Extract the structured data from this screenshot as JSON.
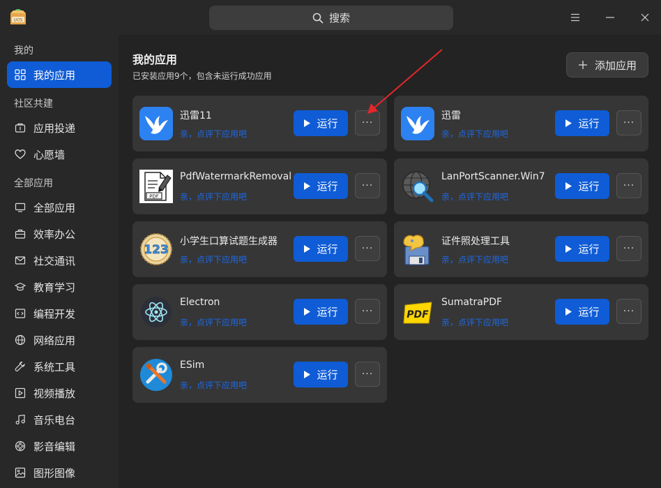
{
  "titlebar": {
    "logo_text": "UOS",
    "search_placeholder": "搜索",
    "icons": [
      "menu-icon",
      "minimize-icon",
      "close-icon"
    ]
  },
  "sidebar": {
    "groups": [
      {
        "label": "我的",
        "items": [
          {
            "label": "我的应用",
            "icon": "grid-icon",
            "active": true
          }
        ]
      },
      {
        "label": "社区共建",
        "items": [
          {
            "label": "应用投递",
            "icon": "upload-icon"
          },
          {
            "label": "心愿墙",
            "icon": "heart-icon"
          }
        ]
      },
      {
        "label": "全部应用",
        "items": [
          {
            "label": "全部应用",
            "icon": "monitor-icon"
          },
          {
            "label": "效率办公",
            "icon": "briefcase-icon"
          },
          {
            "label": "社交通讯",
            "icon": "mail-icon"
          },
          {
            "label": "教育学习",
            "icon": "graduation-cap-icon"
          },
          {
            "label": "编程开发",
            "icon": "code-icon"
          },
          {
            "label": "网络应用",
            "icon": "globe-icon"
          },
          {
            "label": "系统工具",
            "icon": "wrench-icon"
          },
          {
            "label": "视频播放",
            "icon": "play-icon"
          },
          {
            "label": "音乐电台",
            "icon": "music-icon"
          },
          {
            "label": "影音编辑",
            "icon": "film-reel-icon"
          },
          {
            "label": "图形图像",
            "icon": "image-icon"
          }
        ]
      }
    ]
  },
  "main": {
    "title": "我的应用",
    "subtitle": "已安装应用9个，包含未运行成功应用",
    "add_label": "添加应用",
    "run_label": "运行",
    "rate_label": "亲，点评下应用吧",
    "more_label": "···",
    "apps": [
      {
        "name": "迅雷11",
        "icon": "thunder-icon"
      },
      {
        "name": "迅雷",
        "icon": "thunder-icon"
      },
      {
        "name": "PdfWatermarkRemoval",
        "icon": "pdf-watermark-icon"
      },
      {
        "name": "LanPortScanner.Win7",
        "icon": "port-scanner-icon"
      },
      {
        "name": "小学生口算试题生成器",
        "icon": "math-123-icon"
      },
      {
        "name": "证件照处理工具",
        "icon": "photo-tool-icon"
      },
      {
        "name": "Electron",
        "icon": "electron-icon"
      },
      {
        "name": "SumatraPDF",
        "icon": "sumatra-pdf-icon"
      },
      {
        "name": "ESim",
        "icon": "esim-tools-icon"
      }
    ]
  },
  "colors": {
    "accent": "#0f5cd6",
    "link": "#1e69e6",
    "annotation_arrow": "#e5262a"
  }
}
